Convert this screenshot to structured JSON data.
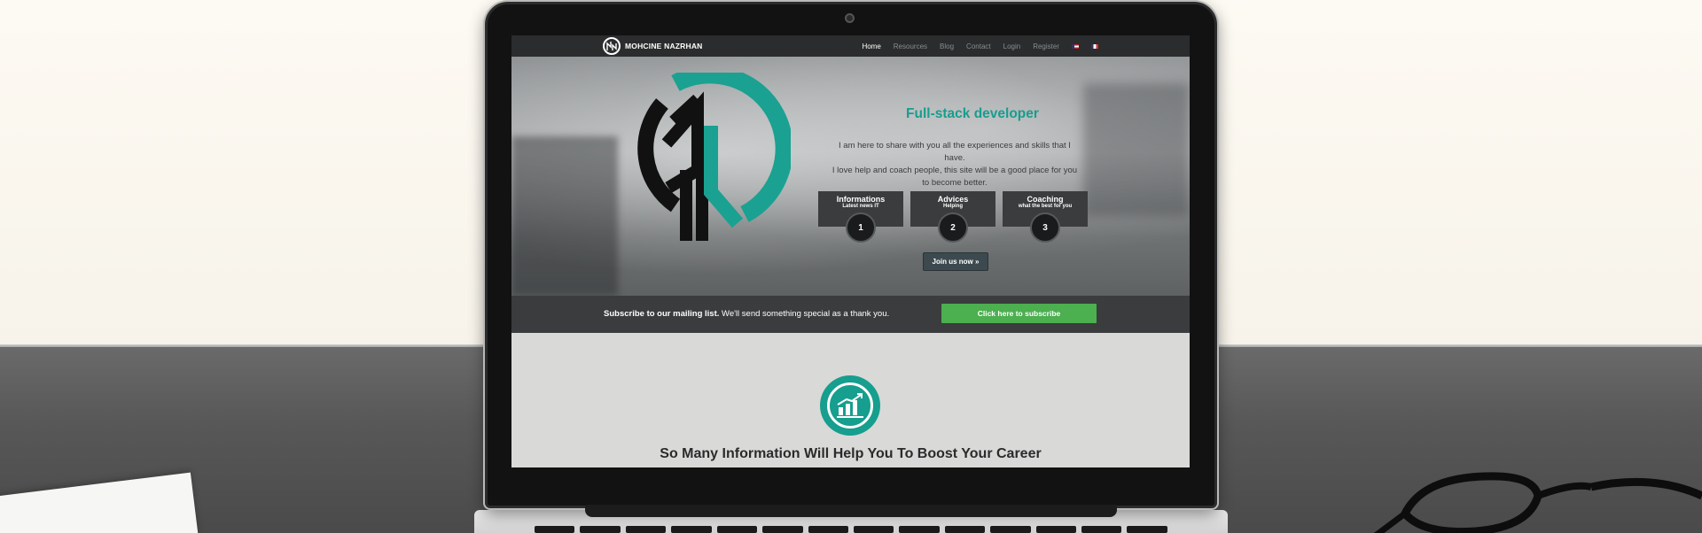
{
  "nav": {
    "brand": "MOHCINE NAZRHAN",
    "links": [
      "Home",
      "Resources",
      "Blog",
      "Contact",
      "Login",
      "Register"
    ],
    "active": "Home",
    "flags": [
      "flag-us-icon",
      "flag-fr-icon"
    ]
  },
  "hero": {
    "title": "Full-stack developer",
    "text_line1": "I am here to share with you all the experiences and skills that I",
    "text_line2": "have.",
    "text_line3": "I love help and coach people, this site will be a good place for you",
    "text_line4": "to become better.",
    "features": [
      {
        "title": "Informations",
        "subtitle": "Latest news IT",
        "number": "1"
      },
      {
        "title": "Advices",
        "subtitle": "Helping",
        "number": "2"
      },
      {
        "title": "Coaching",
        "subtitle": "what the best for you",
        "number": "3"
      }
    ],
    "cta": "Join us now »"
  },
  "mailing": {
    "bold": "Subscribe to our mailing list.",
    "text": " We'll send something special as a thank you.",
    "button": "Click here to subscribe"
  },
  "info": {
    "icon": "growth-chart-icon",
    "title": "So Many Information Will Help You To Boost Your Career"
  },
  "colors": {
    "accent": "#169e8e",
    "subscribe_green": "#4caf50",
    "navbar": "#2a2c2d"
  }
}
